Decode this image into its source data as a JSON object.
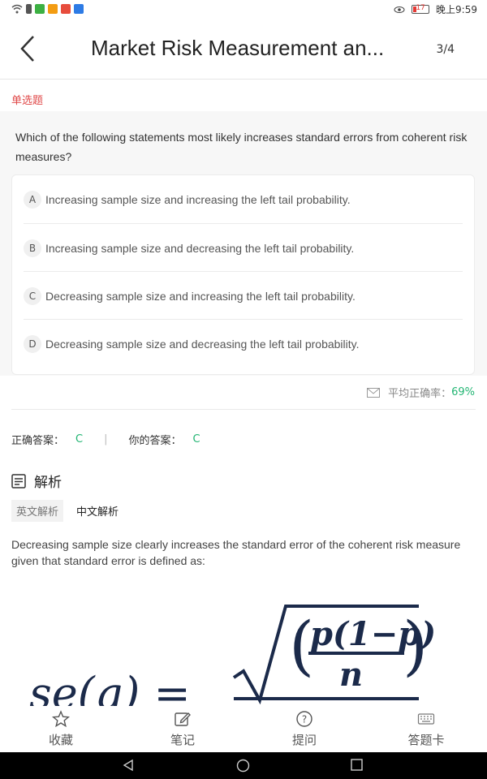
{
  "status_bar": {
    "time": "晚上9:59",
    "battery": "17"
  },
  "header": {
    "title": "Market Risk Measurement an...",
    "counter": "3/4"
  },
  "question_type": "单选题",
  "question": "Which of the following statements most likely increases standard errors from coherent risk measures?",
  "options": [
    {
      "letter": "A",
      "text": "Increasing sample size and increasing the left tail probability."
    },
    {
      "letter": "B",
      "text": "Increasing sample size and decreasing the left tail probability."
    },
    {
      "letter": "C",
      "text": "Decreasing sample size and increasing the left tail probability."
    },
    {
      "letter": "D",
      "text": "Decreasing sample size and decreasing the left tail probability."
    }
  ],
  "accuracy": {
    "label": "平均正确率：",
    "value": "69%"
  },
  "answers": {
    "correct_label": "正确答案：",
    "correct_value": "C",
    "separator": "|",
    "yours_label": "你的答案：",
    "yours_value": "C"
  },
  "analysis": {
    "heading": "解析",
    "tabs": [
      "英文解析",
      "中文解析"
    ],
    "text": "Decreasing sample size clearly increases the standard error of the coherent risk measure given that standard error is defined as:"
  },
  "formula": {
    "lhs": "se(q) =",
    "numerator": "p(1−p)",
    "denominator": "n"
  },
  "toolbar": [
    "收藏",
    "笔记",
    "提问",
    "答题卡"
  ],
  "colors": {
    "accent_red": "#e04848",
    "accent_green": "#22b573"
  }
}
